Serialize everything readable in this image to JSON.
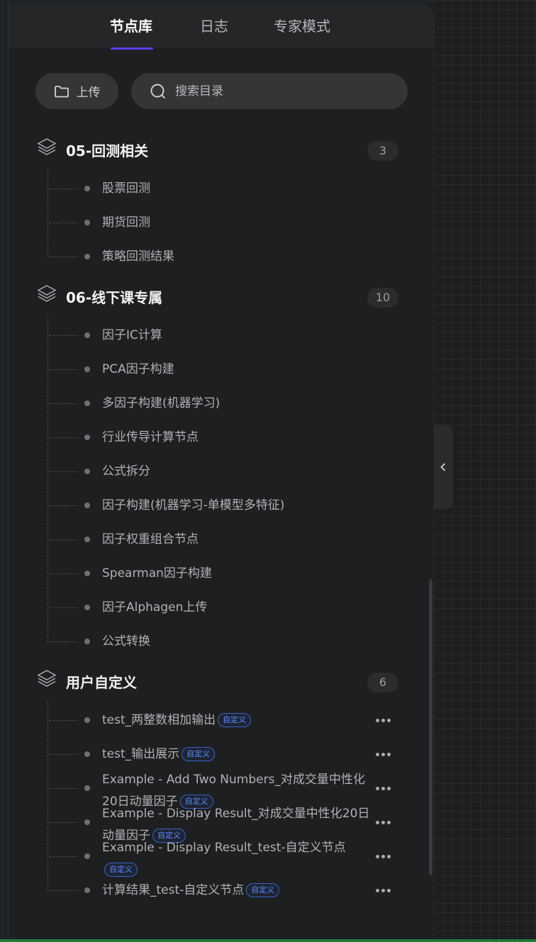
{
  "tabs": [
    {
      "label": "节点库",
      "active": true
    },
    {
      "label": "日志",
      "active": false
    },
    {
      "label": "专家模式",
      "active": false
    }
  ],
  "toolbar": {
    "upload_label": "上传",
    "upload_icon": "folder-icon",
    "search_placeholder": "搜索目录",
    "search_icon": "search-icon"
  },
  "categories": [
    {
      "title": "05-回测相关",
      "count": "3",
      "icon": "layers-icon",
      "items": [
        {
          "label": "股票回测"
        },
        {
          "label": "期货回测"
        },
        {
          "label": "策略回测结果"
        }
      ]
    },
    {
      "title": "06-线下课专属",
      "count": "10",
      "icon": "layers-icon",
      "items": [
        {
          "label": "因子IC计算"
        },
        {
          "label": "PCA因子构建"
        },
        {
          "label": "多因子构建(机器学习)"
        },
        {
          "label": "行业传导计算节点"
        },
        {
          "label": "公式拆分"
        },
        {
          "label": "因子构建(机器学习-单模型多特征)"
        },
        {
          "label": "因子权重组合节点"
        },
        {
          "label": "Spearman因子构建"
        },
        {
          "label": "因子Alphagen上传"
        },
        {
          "label": "公式转换"
        }
      ]
    },
    {
      "title": "用户自定义",
      "count": "6",
      "icon": "layers-icon",
      "items": [
        {
          "label": "test_两整数相加输出",
          "badge": "自定义"
        },
        {
          "label": "test_输出展示",
          "badge": "自定义"
        },
        {
          "label": "Example - Add Two Numbers_对成交量中性化20日动量因子",
          "badge": "自定义"
        },
        {
          "label": "Example - Display Result_对成交量中性化20日动量因子",
          "badge": "自定义"
        },
        {
          "label": "Example - Display Result_test-自定义节点",
          "badge": "自定义"
        },
        {
          "label": "计算结果_test-自定义节点",
          "badge": "自定义"
        }
      ]
    }
  ],
  "colors": {
    "accent": "#5b3cf5",
    "badge": "#5a8bff",
    "panel_bg": "#1e1f21"
  }
}
